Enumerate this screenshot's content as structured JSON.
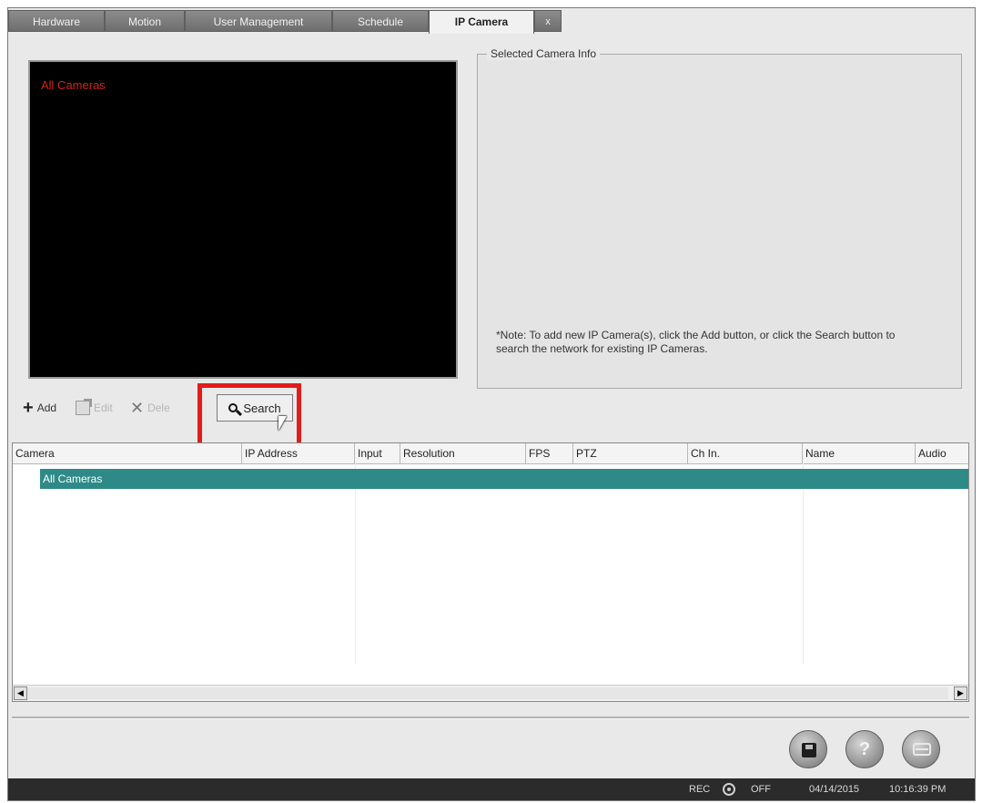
{
  "tabs": [
    {
      "label": "Hardware"
    },
    {
      "label": "Motion"
    },
    {
      "label": "User Management"
    },
    {
      "label": "Schedule"
    },
    {
      "label": "IP Camera",
      "active": true
    },
    {
      "label": "x"
    }
  ],
  "preview": {
    "label": "All Cameras"
  },
  "info": {
    "legend": "Selected Camera Info",
    "note": "*Note: To add new IP Camera(s), click the Add button, or click the Search button to search the network for existing IP Cameras."
  },
  "toolbar": {
    "add_label": "Add",
    "edit_label": "Edit",
    "delete_label": "Dele",
    "search_label": "Search"
  },
  "table": {
    "columns": [
      "Camera",
      "IP Address",
      "Input",
      "Resolution",
      "FPS",
      "PTZ",
      "Ch In.",
      "Name",
      "Audio"
    ],
    "rows": [
      {
        "camera": "All Cameras"
      }
    ]
  },
  "status": {
    "rec_label": "REC",
    "rec_state": "OFF",
    "date": "04/14/2015",
    "time": "10:16:39 PM"
  },
  "colors": {
    "highlight": "#e31b1b",
    "selected_row": "#2e8a86",
    "preview_label": "#d0221f"
  }
}
